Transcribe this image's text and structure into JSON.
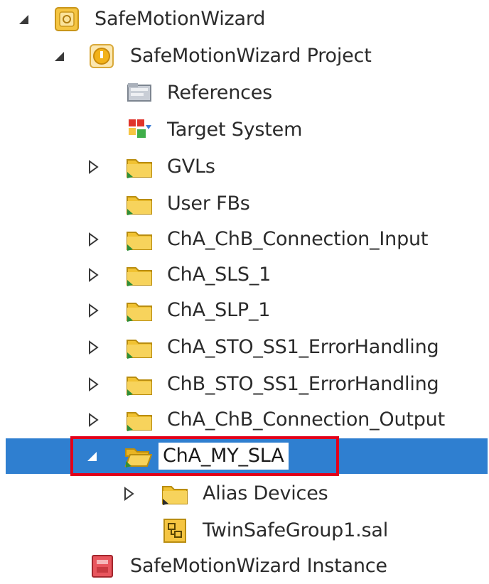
{
  "tree": {
    "items": [
      {
        "label": "SafeMotionWizard",
        "icon": "safety-project-icon",
        "toggle": "expanded"
      },
      {
        "label": "SafeMotionWizard Project",
        "icon": "project-icon",
        "toggle": "expanded"
      },
      {
        "label": "References",
        "icon": "references-icon",
        "toggle": "none"
      },
      {
        "label": "Target System",
        "icon": "target-system-icon",
        "toggle": "none"
      },
      {
        "label": "GVLs",
        "icon": "folder-icon",
        "toggle": "collapsed"
      },
      {
        "label": "User FBs",
        "icon": "folder-icon",
        "toggle": "none"
      },
      {
        "label": "ChA_ChB_Connection_Input",
        "icon": "folder-icon",
        "toggle": "collapsed"
      },
      {
        "label": "ChA_SLS_1",
        "icon": "folder-icon",
        "toggle": "collapsed"
      },
      {
        "label": "ChA_SLP_1",
        "icon": "folder-icon",
        "toggle": "collapsed"
      },
      {
        "label": "ChA_STO_SS1_ErrorHandling",
        "icon": "folder-icon",
        "toggle": "collapsed"
      },
      {
        "label": "ChB_STO_SS1_ErrorHandling",
        "icon": "folder-icon",
        "toggle": "collapsed"
      },
      {
        "label": "ChA_ChB_Connection_Output",
        "icon": "folder-icon",
        "toggle": "collapsed"
      },
      {
        "label": "ChA_MY_SLA",
        "icon": "folder-open-icon",
        "toggle": "expanded",
        "selected": true,
        "editing": true
      },
      {
        "label": "Alias Devices",
        "icon": "folder-icon",
        "toggle": "collapsed"
      },
      {
        "label": "TwinSafeGroup1.sal",
        "icon": "safety-logic-file-icon",
        "toggle": "none"
      },
      {
        "label": "SafeMotionWizard Instance",
        "icon": "instance-icon",
        "toggle": "none"
      }
    ]
  },
  "colors": {
    "selection": "#2f7fd0",
    "annotation_box": "#e2001a",
    "folder": "#f1c232",
    "text": "#2b2b2b"
  }
}
